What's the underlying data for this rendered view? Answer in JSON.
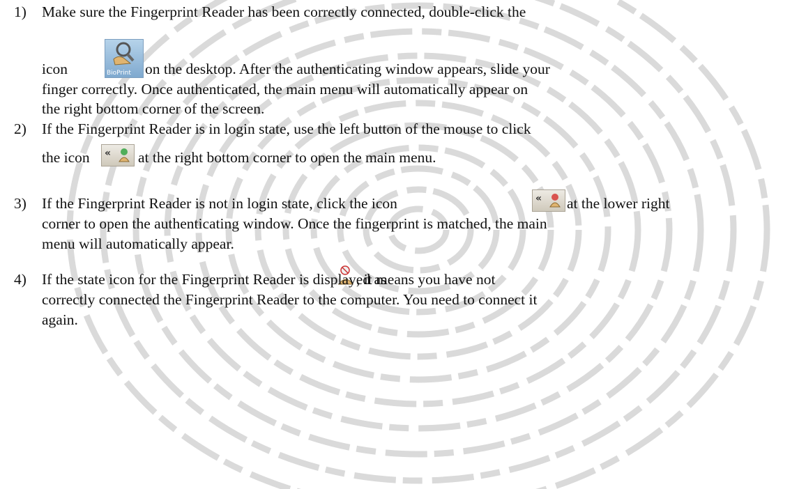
{
  "items": [
    {
      "num": "1)",
      "lines": [
        "Make sure the Fingerprint Reader has been correctly connected, double-click the",
        "icon",
        "on the desktop. After the authenticating window appears, slide your",
        "finger correctly. Once authenticated, the main menu will automatically appear on",
        "the right bottom corner of the screen."
      ],
      "icon_name": "bioprint-desktop-icon",
      "icon_label": "BioPrint"
    },
    {
      "num": "2)",
      "lines": [
        "If the Fingerprint Reader is in login state, use the left button of the mouse to click",
        "the icon",
        "at the right bottom corner to open the main menu."
      ],
      "icon_name": "tray-login-state-icon"
    },
    {
      "num": "3)",
      "lines": [
        "If the Fingerprint Reader is not in login state, click the icon",
        "at the lower right",
        "corner to open the authenticating window. Once the fingerprint is matched, the main",
        "menu will automatically appear."
      ],
      "icon_name": "tray-logout-state-icon"
    },
    {
      "num": "4)",
      "lines": [
        "If the state icon for the Fingerprint Reader is displayed as",
        ", it means you have not",
        "correctly connected the Fingerprint Reader to the computer. You need to connect it",
        "again."
      ],
      "icon_name": "disconnected-state-icon"
    }
  ],
  "colors": {
    "text": "#111111",
    "watermark": "#d9d9d9"
  }
}
